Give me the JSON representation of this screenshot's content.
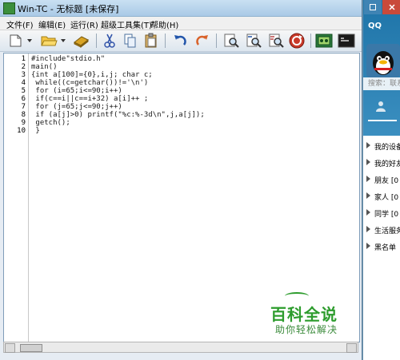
{
  "window": {
    "title": "Win-TC - 无标题 [未保存]"
  },
  "menu": [
    "文件(F)",
    "编辑(E)",
    "运行(R)",
    "超级工具集(T)",
    "帮助(H)"
  ],
  "toolbar": {
    "icons": [
      "new-file-icon",
      "open-folder-icon",
      "save-icon",
      "cut-icon",
      "copy-icon",
      "paste-icon",
      "undo-icon",
      "redo-icon",
      "find-icon",
      "find-next-icon",
      "replace-icon",
      "refresh-icon",
      "compile-icon",
      "run-icon"
    ]
  },
  "editor": {
    "line_numbers": [
      "1",
      "2",
      "3",
      "4",
      "5",
      "6",
      "7",
      "8",
      "9",
      "10"
    ],
    "lines": [
      "#include\"stdio.h\"",
      "main()",
      "{int a[100]={0},i,j; char c;",
      " while((c=getchar())!='\\n')",
      " for (i=65;i<=90;i++)",
      " if(c==i||c==i+32) a[i]++ ;",
      " for (j=65;j<=90;j++)",
      " if (a[j]>0) printf(\"%c:%-3d\\n\",j,a[j]);",
      " getch();",
      " }"
    ]
  },
  "qq_panel": {
    "title": "QQ",
    "search_placeholder": "搜索：联系",
    "groups": [
      "我的设备",
      "我的好友",
      "朋友 [0",
      "家人 [0",
      "同学 [0",
      "生活服务",
      "黑名单"
    ]
  },
  "watermark": {
    "brand": "百科全说",
    "slogan": "助你轻松解决"
  },
  "colors": {
    "title_bar": "#a9c9e6",
    "close_button": "#c94a3a",
    "keyword": "#000000",
    "qq_blue": "#1e74a8",
    "watermark_green": "#2d9c2d"
  }
}
